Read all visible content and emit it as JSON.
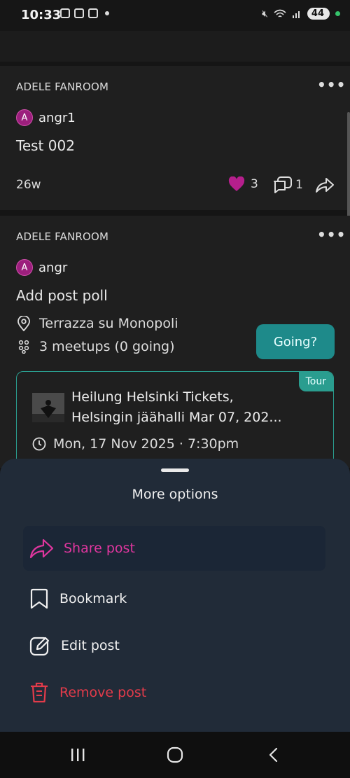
{
  "status_bar": {
    "time": "10:33",
    "battery": "44"
  },
  "posts": [
    {
      "community": "ADELE FANROOM",
      "author_initial": "A",
      "author": "angr1",
      "text": "Test 002",
      "age": "26w",
      "likes": "3",
      "comments": "1"
    },
    {
      "community": "ADELE FANROOM",
      "author_initial": "A",
      "author": "angr",
      "text": "Add post poll",
      "location": "Terrazza su Monopoli",
      "meetups": "3 meetups (0 going)",
      "going_button": "Going?",
      "event": {
        "badge": "Tour",
        "title_line1": "Heilung Helsinki Tickets,",
        "title_line2": "Helsingin jäähalli Mar 07, 202...",
        "datetime": "Mon, 17 Nov 2025 · 7:30pm"
      }
    }
  ],
  "sheet": {
    "title": "More options",
    "options": [
      {
        "label": "Share post",
        "icon": "share-icon",
        "color": "#e0369f"
      },
      {
        "label": "Bookmark",
        "icon": "bookmark-icon",
        "color": "#f0f0f0"
      },
      {
        "label": "Edit post",
        "icon": "edit-icon",
        "color": "#f0f0f0"
      },
      {
        "label": "Remove post",
        "icon": "trash-icon",
        "color": "#e23b4a"
      }
    ]
  },
  "colors": {
    "accent": "#e0369f",
    "teal": "#2a9d8f",
    "danger": "#e23b4a"
  }
}
